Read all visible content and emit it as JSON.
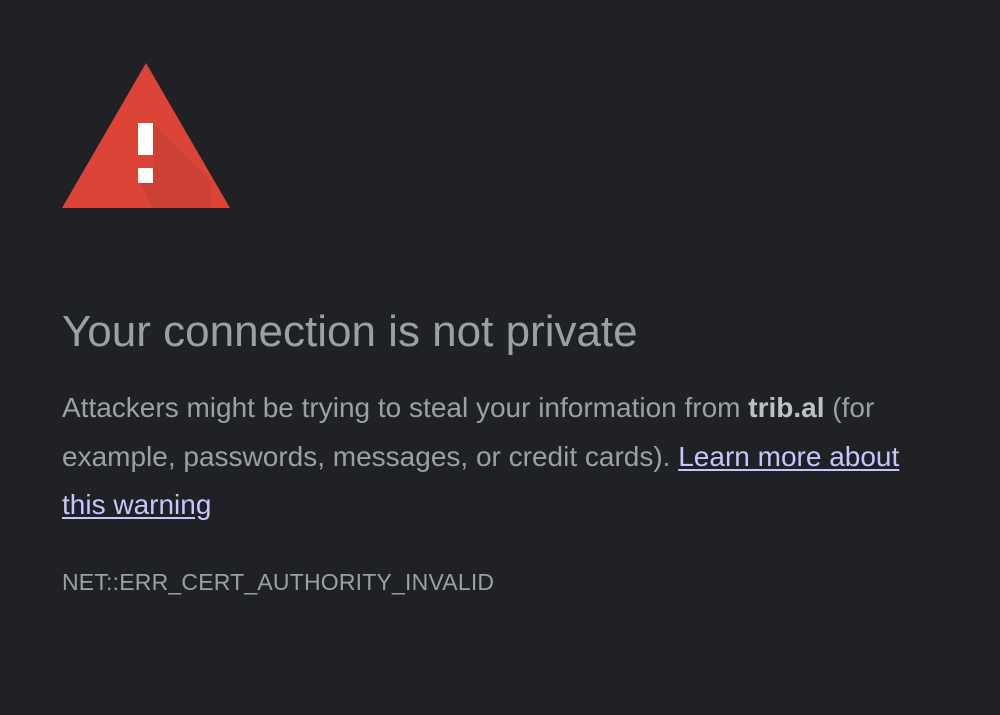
{
  "icon": {
    "name": "warning-triangle-icon",
    "color": "#db4437",
    "shadow_color": "#b83a2f",
    "mark_color": "#ffffff"
  },
  "heading": "Your connection is not private",
  "body": {
    "text_before_host": "Attackers might be trying to steal your information from ",
    "host": "trib.al",
    "text_after_host": " (for example, passwords, messages, or credit cards). ",
    "learn_more_link": "Learn more about this warning"
  },
  "error_code": "NET::ERR_CERT_AUTHORITY_INVALID",
  "colors": {
    "background": "#202124",
    "text": "#9aa0a6",
    "link": "#c9c4ff"
  }
}
